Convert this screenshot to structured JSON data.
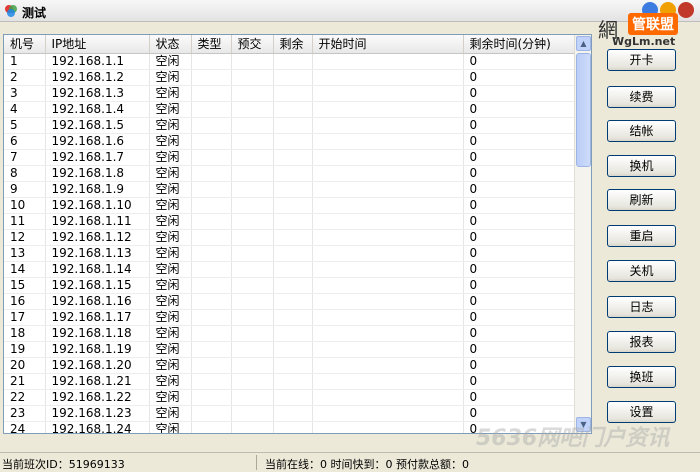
{
  "window": {
    "title": "测试"
  },
  "logo": {
    "brand_char": "網",
    "brand_label": "管联盟",
    "domain": "WgLm.net",
    "colors": [
      "#3c7be0",
      "#c0392b",
      "#f0a000"
    ]
  },
  "table": {
    "columns": [
      "机号",
      "IP地址",
      "状态",
      "类型",
      "预交",
      "剩余",
      "开始时间",
      "剩余时间(分钟)"
    ],
    "rows": [
      [
        "1",
        "192.168.1.1",
        "空闲",
        "",
        "",
        "",
        "",
        "0"
      ],
      [
        "2",
        "192.168.1.2",
        "空闲",
        "",
        "",
        "",
        "",
        "0"
      ],
      [
        "3",
        "192.168.1.3",
        "空闲",
        "",
        "",
        "",
        "",
        "0"
      ],
      [
        "4",
        "192.168.1.4",
        "空闲",
        "",
        "",
        "",
        "",
        "0"
      ],
      [
        "5",
        "192.168.1.5",
        "空闲",
        "",
        "",
        "",
        "",
        "0"
      ],
      [
        "6",
        "192.168.1.6",
        "空闲",
        "",
        "",
        "",
        "",
        "0"
      ],
      [
        "7",
        "192.168.1.7",
        "空闲",
        "",
        "",
        "",
        "",
        "0"
      ],
      [
        "8",
        "192.168.1.8",
        "空闲",
        "",
        "",
        "",
        "",
        "0"
      ],
      [
        "9",
        "192.168.1.9",
        "空闲",
        "",
        "",
        "",
        "",
        "0"
      ],
      [
        "10",
        "192.168.1.10",
        "空闲",
        "",
        "",
        "",
        "",
        "0"
      ],
      [
        "11",
        "192.168.1.11",
        "空闲",
        "",
        "",
        "",
        "",
        "0"
      ],
      [
        "12",
        "192.168.1.12",
        "空闲",
        "",
        "",
        "",
        "",
        "0"
      ],
      [
        "13",
        "192.168.1.13",
        "空闲",
        "",
        "",
        "",
        "",
        "0"
      ],
      [
        "14",
        "192.168.1.14",
        "空闲",
        "",
        "",
        "",
        "",
        "0"
      ],
      [
        "15",
        "192.168.1.15",
        "空闲",
        "",
        "",
        "",
        "",
        "0"
      ],
      [
        "16",
        "192.168.1.16",
        "空闲",
        "",
        "",
        "",
        "",
        "0"
      ],
      [
        "17",
        "192.168.1.17",
        "空闲",
        "",
        "",
        "",
        "",
        "0"
      ],
      [
        "18",
        "192.168.1.18",
        "空闲",
        "",
        "",
        "",
        "",
        "0"
      ],
      [
        "19",
        "192.168.1.19",
        "空闲",
        "",
        "",
        "",
        "",
        "0"
      ],
      [
        "20",
        "192.168.1.20",
        "空闲",
        "",
        "",
        "",
        "",
        "0"
      ],
      [
        "21",
        "192.168.1.21",
        "空闲",
        "",
        "",
        "",
        "",
        "0"
      ],
      [
        "22",
        "192.168.1.22",
        "空闲",
        "",
        "",
        "",
        "",
        "0"
      ],
      [
        "23",
        "192.168.1.23",
        "空闲",
        "",
        "",
        "",
        "",
        "0"
      ],
      [
        "24",
        "192.168.1.24",
        "空闲",
        "",
        "",
        "",
        "",
        "0"
      ]
    ]
  },
  "buttons": [
    "开卡",
    "续费",
    "结帐",
    "换机",
    "刷新",
    "重启",
    "关机",
    "日志",
    "报表",
    "换班",
    "设置"
  ],
  "status": {
    "shift_id": "当前班次ID：51969133",
    "online_summary": "当前在线：0 时间快到：0 预付款总额：0"
  },
  "watermark": "5636网吧门户资讯"
}
